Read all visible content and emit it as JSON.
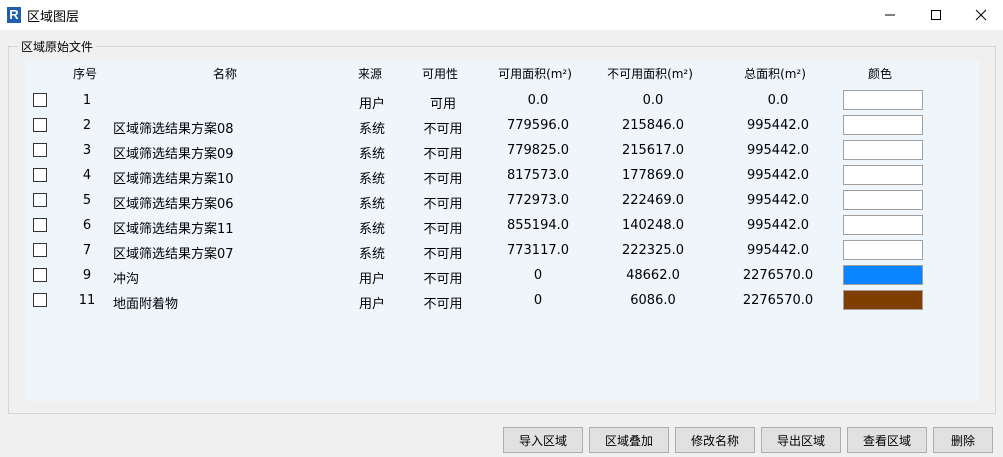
{
  "window": {
    "app_icon_letter": "R",
    "title": "区域图层"
  },
  "group": {
    "label": "区域原始文件"
  },
  "table": {
    "headers": {
      "index": "序号",
      "name": "名称",
      "source": "来源",
      "availability": "可用性",
      "usable_area": "可用面积(m²)",
      "unusable_area": "不可用面积(m²)",
      "total_area": "总面积(m²)",
      "color": "颜色"
    },
    "rows": [
      {
        "index": "1",
        "name": "",
        "source": "用户",
        "availability": "可用",
        "usable_area": "0.0",
        "unusable_area": "0.0",
        "total_area": "0.0",
        "color": "#ffffff",
        "checked": false
      },
      {
        "index": "2",
        "name": "区域筛选结果方案08",
        "source": "系统",
        "availability": "不可用",
        "usable_area": "779596.0",
        "unusable_area": "215846.0",
        "total_area": "995442.0",
        "color": "#ffffff",
        "checked": false
      },
      {
        "index": "3",
        "name": "区域筛选结果方案09",
        "source": "系统",
        "availability": "不可用",
        "usable_area": "779825.0",
        "unusable_area": "215617.0",
        "total_area": "995442.0",
        "color": "#ffffff",
        "checked": false
      },
      {
        "index": "4",
        "name": "区域筛选结果方案10",
        "source": "系统",
        "availability": "不可用",
        "usable_area": "817573.0",
        "unusable_area": "177869.0",
        "total_area": "995442.0",
        "color": "#ffffff",
        "checked": false
      },
      {
        "index": "5",
        "name": "区域筛选结果方案06",
        "source": "系统",
        "availability": "不可用",
        "usable_area": "772973.0",
        "unusable_area": "222469.0",
        "total_area": "995442.0",
        "color": "#ffffff",
        "checked": false
      },
      {
        "index": "6",
        "name": "区域筛选结果方案11",
        "source": "系统",
        "availability": "不可用",
        "usable_area": "855194.0",
        "unusable_area": "140248.0",
        "total_area": "995442.0",
        "color": "#ffffff",
        "checked": false
      },
      {
        "index": "7",
        "name": "区域筛选结果方案07",
        "source": "系统",
        "availability": "不可用",
        "usable_area": "773117.0",
        "unusable_area": "222325.0",
        "total_area": "995442.0",
        "color": "#ffffff",
        "checked": false
      },
      {
        "index": "9",
        "name": "冲沟",
        "source": "用户",
        "availability": "不可用",
        "usable_area": "0",
        "unusable_area": "48662.0",
        "total_area": "2276570.0",
        "color": "#0a84ff",
        "checked": false
      },
      {
        "index": "11",
        "name": "地面附着物",
        "source": "用户",
        "availability": "不可用",
        "usable_area": "0",
        "unusable_area": "6086.0",
        "total_area": "2276570.0",
        "color": "#7f3f00",
        "checked": false
      }
    ]
  },
  "buttons": {
    "import_region": "导入区域",
    "overlay_region": "区域叠加",
    "rename": "修改名称",
    "export_region": "导出区域",
    "view_region": "查看区域",
    "delete": "删除"
  }
}
